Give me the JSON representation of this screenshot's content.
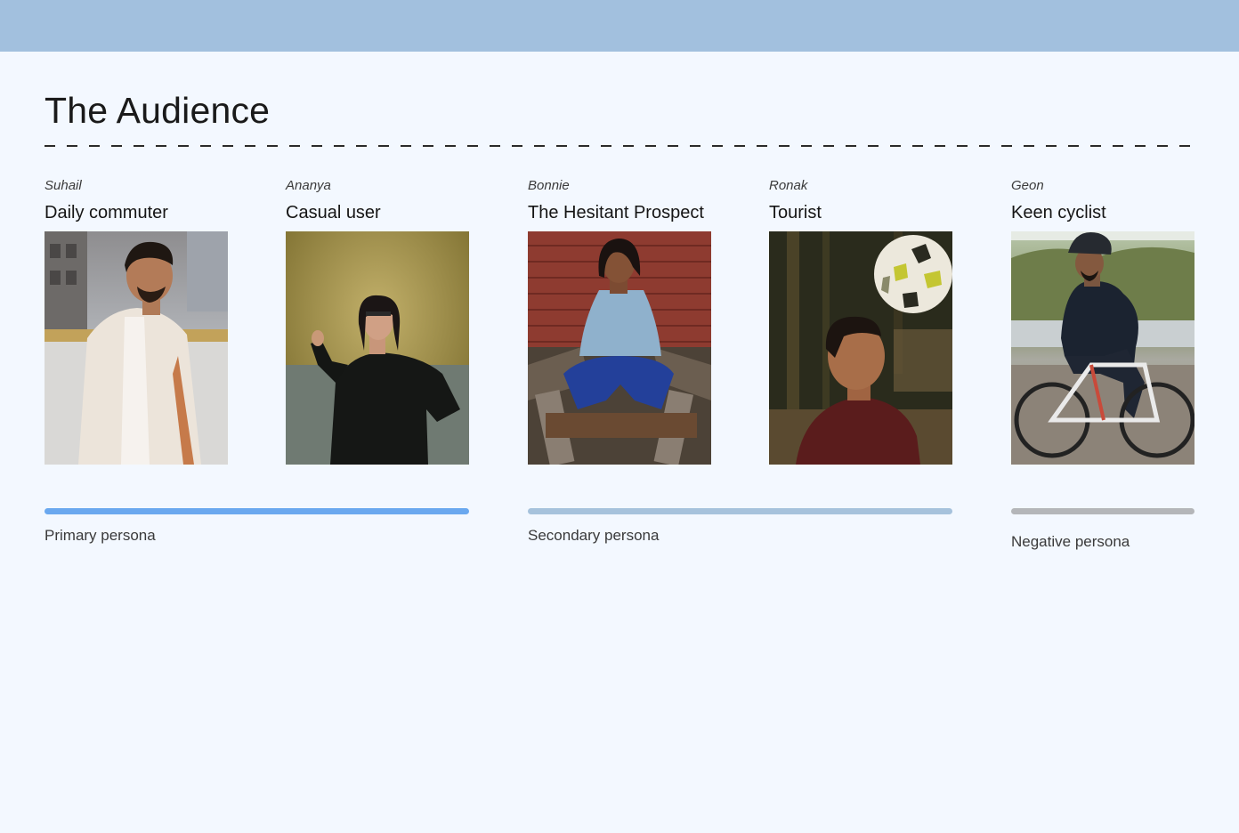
{
  "header": {
    "title": "The Audience"
  },
  "personas": [
    {
      "name": "Suhail",
      "role": "Daily commuter"
    },
    {
      "name": "Ananya",
      "role": "Casual user"
    },
    {
      "name": "Bonnie",
      "role": "The Hesitant Prospect"
    },
    {
      "name": "Ronak",
      "role": "Tourist"
    },
    {
      "name": "Geon",
      "role": "Keen cyclist"
    }
  ],
  "groups": [
    {
      "label": "Primary persona",
      "color": "#6aa8ef"
    },
    {
      "label": "Secondary persona",
      "color": "#a6c2dc"
    },
    {
      "label": "Negative persona",
      "color": "#b4b6b9"
    }
  ],
  "colors": {
    "band": "#a2c0de",
    "background": "#f3f8ff"
  }
}
